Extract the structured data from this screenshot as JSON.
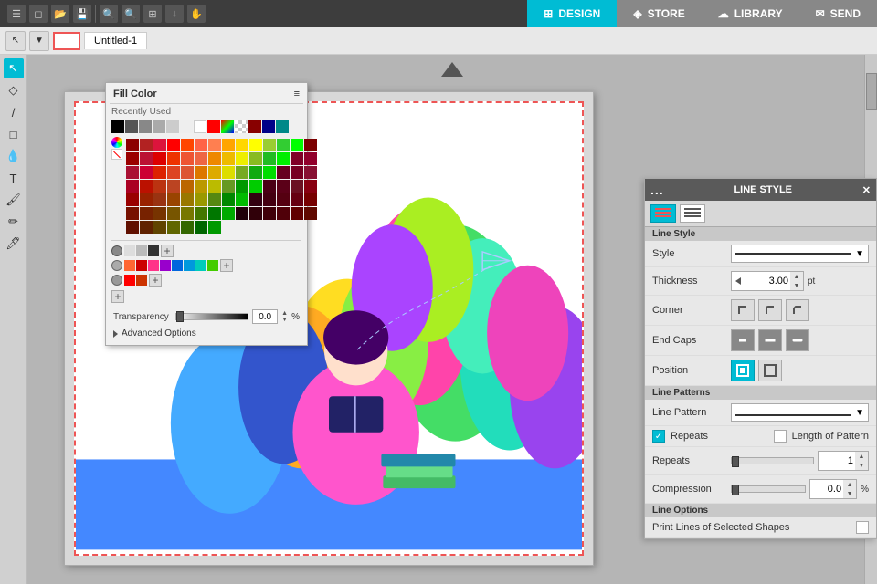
{
  "topbar": {
    "icons": [
      "☰",
      "◻",
      "◼",
      "◻",
      "✎",
      "⟲"
    ],
    "tabs": [
      {
        "label": "DESIGN",
        "icon": "⊞",
        "active": true
      },
      {
        "label": "STORE",
        "icon": "◈",
        "active": false
      },
      {
        "label": "LIBRARY",
        "icon": "☁",
        "active": false
      },
      {
        "label": "SEND",
        "icon": "✉",
        "active": false
      }
    ]
  },
  "toolrow": {
    "doc_tab": "Untitled-1"
  },
  "fill_popup": {
    "title": "Fill Color",
    "recently_used_label": "Recently Used",
    "transparency_label": "Transparency",
    "transparency_value": "0.0",
    "percent": "%",
    "advanced_label": "Advanced Options",
    "menu_icon": "≡"
  },
  "line_style_panel": {
    "title": "LINE STYLE",
    "close_icon": "✕",
    "menu_icon": "…",
    "tabs": [
      {
        "icon": "≡",
        "active": true
      },
      {
        "icon": "≡",
        "active": false
      }
    ],
    "line_style_section": "Line Style",
    "style_label": "Style",
    "thickness_label": "Thickness",
    "thickness_value": "3.00",
    "thickness_unit": "pt",
    "corner_label": "Corner",
    "end_caps_label": "End Caps",
    "position_label": "Position",
    "line_patterns_section": "Line Patterns",
    "line_pattern_label": "Line Pattern",
    "repeats_checkbox_label": "Repeats",
    "length_checkbox_label": "Length of Pattern",
    "repeats_label": "Repeats",
    "repeats_value": "1",
    "compression_label": "Compression",
    "compression_value": "0.0",
    "compression_percent": "%",
    "line_options_section": "Line Options",
    "print_lines_label": "Print Lines of Selected Shapes"
  },
  "colors": {
    "recently_used": [
      "#000000",
      "#555555",
      "#888888",
      "#aaaaaa",
      "#cccccc",
      "#eeeeee",
      "#ffffff",
      "#ff0000",
      "#00ff00",
      "#0000ff",
      "#ffff00",
      "#ff00ff",
      "#00ffff"
    ],
    "grid_colors": [
      "#8B0000",
      "#B22222",
      "#DC143C",
      "#FF0000",
      "#FF4500",
      "#FF6347",
      "#FF7F50",
      "#FFA500",
      "#FFD700",
      "#FFFF00",
      "#9ACD32",
      "#32CD32",
      "#00FF00",
      "#7B0000",
      "#9B0000",
      "#BB1133",
      "#DD0000",
      "#EE3300",
      "#EE5533",
      "#EE6644",
      "#EE8800",
      "#EEBB00",
      "#EEEE00",
      "#88BB22",
      "#22BB22",
      "#00EE00",
      "#800026",
      "#91002B",
      "#AA1133",
      "#CC0033",
      "#DD2200",
      "#DD4422",
      "#DD5533",
      "#DD7700",
      "#DDAA00",
      "#DDDD00",
      "#77AA22",
      "#11AA11",
      "#00DD00",
      "#660020",
      "#770022",
      "#881133",
      "#AA0022",
      "#BB1100",
      "#BB3311",
      "#BB4422",
      "#BB6600",
      "#BB9900",
      "#BBBB00",
      "#669922",
      "#009900",
      "#00CC00",
      "#4B0015",
      "#5B0018",
      "#6B1122",
      "#880011",
      "#990000",
      "#992200",
      "#993311",
      "#994400",
      "#997700",
      "#999900",
      "#558811",
      "#008800",
      "#00BB00",
      "#330010",
      "#440011",
      "#550011",
      "#660011",
      "#770000",
      "#771100",
      "#772200",
      "#773300",
      "#775500",
      "#777700",
      "#447700",
      "#007700",
      "#00AA00",
      "#200009",
      "#300009",
      "#400009",
      "#500009",
      "#600000",
      "#600900",
      "#601000",
      "#602200",
      "#604400",
      "#606600",
      "#336600",
      "#006600",
      "#009900"
    ],
    "accent": "#00bcd4"
  }
}
